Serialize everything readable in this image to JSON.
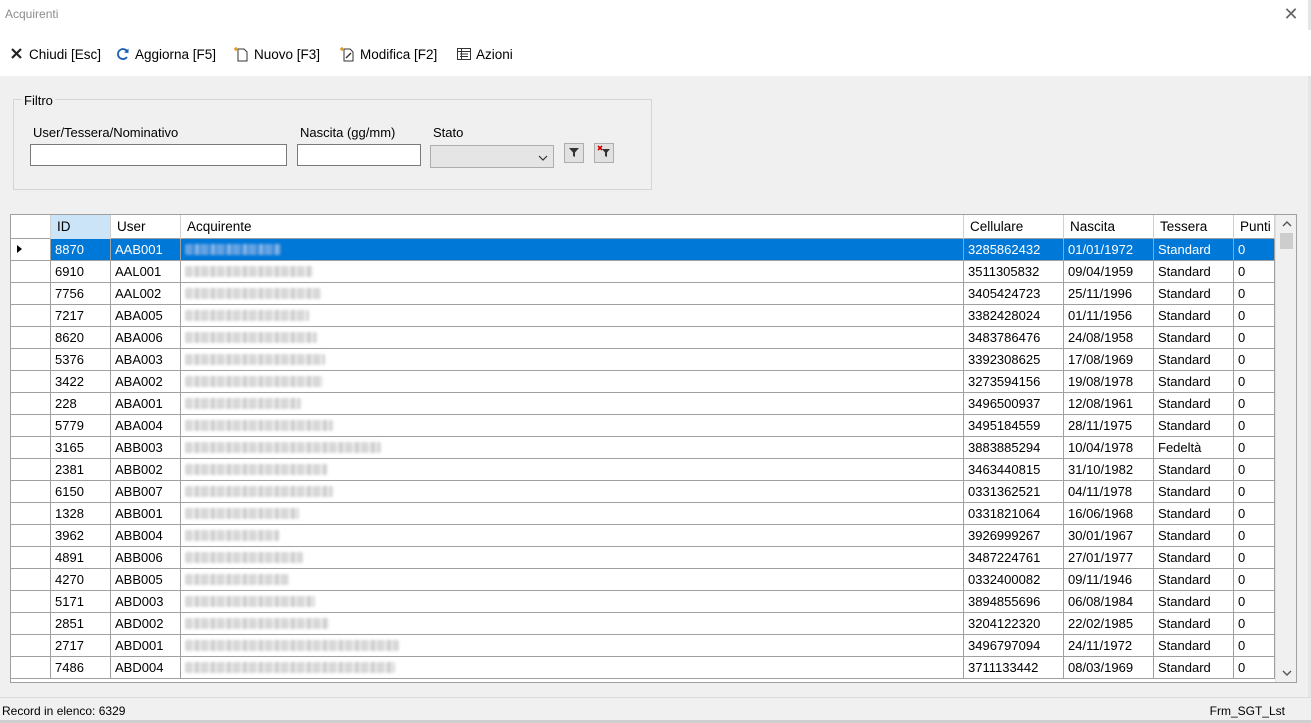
{
  "window": {
    "title": "Acquirenti",
    "close_glyph": "✕"
  },
  "toolbar": {
    "close_label": "Chiudi [Esc]",
    "refresh_label": "Aggiorna [F5]",
    "new_label": "Nuovo [F3]",
    "edit_label": "Modifica [F2]",
    "actions_label": "Azioni"
  },
  "filter": {
    "legend": "Filtro",
    "user_label": "User/Tessera/Nominativo",
    "user_value": "",
    "birth_label": "Nascita (gg/mm)",
    "birth_value": "",
    "status_label": "Stato",
    "status_value": ""
  },
  "grid": {
    "columns": [
      "ID",
      "User",
      "Acquirente",
      "Cellulare",
      "Nascita",
      "Tessera",
      "Punti"
    ],
    "selected_row": 0,
    "rows": [
      {
        "id": "8870",
        "user": "AAB001",
        "phone": "3285862432",
        "birth": "01/01/1972",
        "card": "Standard",
        "points": "0"
      },
      {
        "id": "6910",
        "user": "AAL001",
        "phone": "3511305832",
        "birth": "09/04/1959",
        "card": "Standard",
        "points": "0"
      },
      {
        "id": "7756",
        "user": "AAL002",
        "phone": "3405424723",
        "birth": "25/11/1996",
        "card": "Standard",
        "points": "0"
      },
      {
        "id": "7217",
        "user": "ABA005",
        "phone": "3382428024",
        "birth": "01/11/1956",
        "card": "Standard",
        "points": "0"
      },
      {
        "id": "8620",
        "user": "ABA006",
        "phone": "3483786476",
        "birth": "24/08/1958",
        "card": "Standard",
        "points": "0"
      },
      {
        "id": "5376",
        "user": "ABA003",
        "phone": "3392308625",
        "birth": "17/08/1969",
        "card": "Standard",
        "points": "0"
      },
      {
        "id": "3422",
        "user": "ABA002",
        "phone": "3273594156",
        "birth": "19/08/1978",
        "card": "Standard",
        "points": "0"
      },
      {
        "id": "228",
        "user": "ABA001",
        "phone": "3496500937",
        "birth": "12/08/1961",
        "card": "Standard",
        "points": "0"
      },
      {
        "id": "5779",
        "user": "ABA004",
        "phone": "3495184559",
        "birth": "28/11/1975",
        "card": "Standard",
        "points": "0"
      },
      {
        "id": "3165",
        "user": "ABB003",
        "phone": "3883885294",
        "birth": "10/04/1978",
        "card": "Fedeltà",
        "points": "0"
      },
      {
        "id": "2381",
        "user": "ABB002",
        "phone": "3463440815",
        "birth": "31/10/1982",
        "card": "Standard",
        "points": "0"
      },
      {
        "id": "6150",
        "user": "ABB007",
        "phone": "0331362521",
        "birth": "04/11/1978",
        "card": "Standard",
        "points": "0"
      },
      {
        "id": "1328",
        "user": "ABB001",
        "phone": "0331821064",
        "birth": "16/06/1968",
        "card": "Standard",
        "points": "0"
      },
      {
        "id": "3962",
        "user": "ABB004",
        "phone": "3926999267",
        "birth": "30/01/1967",
        "card": "Standard",
        "points": "0"
      },
      {
        "id": "4891",
        "user": "ABB006",
        "phone": "3487224761",
        "birth": "27/01/1977",
        "card": "Standard",
        "points": "0"
      },
      {
        "id": "4270",
        "user": "ABB005",
        "phone": "0332400082",
        "birth": "09/11/1946",
        "card": "Standard",
        "points": "0"
      },
      {
        "id": "5171",
        "user": "ABD003",
        "phone": "3894855696",
        "birth": "06/08/1984",
        "card": "Standard",
        "points": "0"
      },
      {
        "id": "2851",
        "user": "ABD002",
        "phone": "3204122320",
        "birth": "22/02/1985",
        "card": "Standard",
        "points": "0"
      },
      {
        "id": "2717",
        "user": "ABD001",
        "phone": "3496797094",
        "birth": "24/11/1972",
        "card": "Standard",
        "points": "0"
      },
      {
        "id": "7486",
        "user": "ABD004",
        "phone": "3711133442",
        "birth": "08/03/1969",
        "card": "Standard",
        "points": "0"
      }
    ]
  },
  "status": {
    "left": "Record in elenco: 6329",
    "right": "Frm_SGT_Lst"
  },
  "icons": {
    "close": "close-x-icon",
    "refresh": "refresh-icon",
    "new": "new-document-icon",
    "edit": "edit-document-icon",
    "actions": "actions-list-icon",
    "filter_apply": "filter-icon",
    "filter_clear": "filter-clear-icon"
  },
  "colors": {
    "selection": "#0078d7",
    "header_selected": "#cce4f7"
  }
}
